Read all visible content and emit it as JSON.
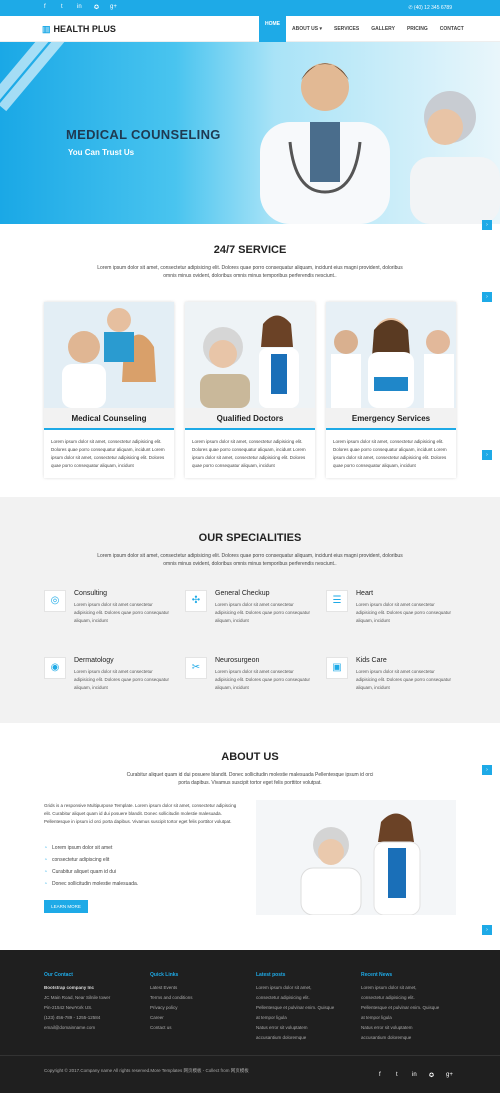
{
  "topbar": {
    "social": [
      "f",
      "t",
      "in",
      "✪",
      "g+"
    ],
    "phone": "(40) 12 345 6789"
  },
  "nav": {
    "brand": "HEALTH PLUS",
    "items": [
      "HOME",
      "ABOUT US ▾",
      "SERVICES",
      "GALLERY",
      "PRICING",
      "CONTACT"
    ]
  },
  "hero": {
    "title": "MEDICAL COUNSELING",
    "subtitle": "You Can Trust Us"
  },
  "service": {
    "title": "24/7 SERVICE",
    "desc": "Lorem ipsum dolor sit amet, consectetur adipisicing elit. Dolores quae porro consequatur aliquam, incidunt eius magni provident, doloribus omnis minus ovident, doloribus omnis minus temporibus perferendis nesciunt..",
    "cards": [
      {
        "label": "Medical Counseling",
        "text": "Lorem ipsum dolor sit amet, consectetur adipisicing elit. Dolores quae porro consequatur aliquam, incidunt Lorem ipsum dolor sit amet, consectetur adipisicing elit. Dolores quae porro consequatur aliquam, incidunt"
      },
      {
        "label": "Qualified Doctors",
        "text": "Lorem ipsum dolor sit amet, consectetur adipisicing elit. Dolores quae porro consequatur aliquam, incidunt Lorem ipsum dolor sit amet, consectetur adipisicing elit. Dolores quae porro consequatur aliquam, incidunt"
      },
      {
        "label": "Emergency Services",
        "text": "Lorem ipsum dolor sit amet, consectetur adipisicing elit. Dolores quae porro consequatur aliquam, incidunt Lorem ipsum dolor sit amet, consectetur adipisicing elit. Dolores quae porro consequatur aliquam, incidunt"
      }
    ]
  },
  "specialities": {
    "title": "OUR SPECIALITIES",
    "desc": "Lorem ipsum dolor sit amet, consectetur adipisicing elit. Dolores quae porro consequatur aliquam, incidunt eius magni provident, doloribus omnis minus ovident, doloribus omnis minus temporibus perferendis nesciunt..",
    "items": [
      {
        "name": "Consulting",
        "text": "Lorem ipsum dolor sit amet consectetur adipisicing elit. Dolores quae porro consequatur aliquam, incidunt"
      },
      {
        "name": "General Checkup",
        "text": "Lorem ipsum dolor sit amet consectetur adipisicing elit. Dolores quae porro consequatur aliquam, incidunt"
      },
      {
        "name": "Heart",
        "text": "Lorem ipsum dolor sit amet consectetur adipisicing elit. Dolores quae porro consequatur aliquam, incidunt"
      },
      {
        "name": "Dermatology",
        "text": "Lorem ipsum dolor sit amet consectetur adipisicing elit. Dolores quae porro consequatur aliquam, incidunt"
      },
      {
        "name": "Neurosurgeon",
        "text": "Lorem ipsum dolor sit amet consectetur adipisicing elit. Dolores quae porro consequatur aliquam, incidunt"
      },
      {
        "name": "Kids Care",
        "text": "Lorem ipsum dolor sit amet consectetur adipisicing elit. Dolores quae porro consequatur aliquam, incidunt"
      }
    ]
  },
  "about": {
    "title": "ABOUT US",
    "desc": "Curabitur aliquet quam id dui posuere blandit. Donec sollicitudin molestie malesuada Pellentesque ipsum id orci porta dapibus. Vivamus suscipit tortor eget felis porttitor volutpat.",
    "text": "Grids is a responsive Multipurpose Template. Lorem ipsum dolor sit amet, consectetur adipiscing elit. Curabitur aliquet quam id dui posuere blandit. Donec sollicitudin molestie malesuada. Pellentesque in ipsum id orci porta dapibus. Vivamus suscipit tortor eget felis porttitor volutpat.",
    "list": [
      "Lorem ipsum dolor sit amet",
      "consectetur adipiscing elit",
      "Curabitur aliquet quam id dui",
      "Donec sollicitudin molestie malesuada."
    ],
    "button": "LEARN MORE"
  },
  "footer": {
    "contact": {
      "h": "Our Contact",
      "lines": [
        "Bootstrap company Inc",
        "JC Main Road, Near Silnile tower",
        "Pin-21542 NewYork US.",
        "(123) 456-789 - 1255-12584",
        "email@domainname.com"
      ]
    },
    "links": {
      "h": "Quick Links",
      "lines": [
        "Latest Events",
        "Terms and conditions",
        "Privacy policy",
        "Career",
        "Contact us"
      ]
    },
    "posts": {
      "h": "Latest posts",
      "lines": [
        "Lorem ipsum dolor sit amet,",
        "consectetur adipisicing elit.",
        "Pellentesque et pulvinar enim. Quisque",
        "at tempor ligula",
        "Natus error sit voluptatem",
        "accusantium doloremque"
      ]
    },
    "news": {
      "h": "Recent News",
      "lines": [
        "Lorem ipsum dolor sit amet,",
        "consectetur adipisicing elit.",
        "Pellentesque et pulvinar enim. Quisque",
        "at tempor ligula",
        "Natus error sit voluptatem",
        "accusantium doloremque"
      ]
    },
    "copyright": "Copyright © 2017.Company name All rights reserved.More Templates 网页模板 - Collect from 网页模板",
    "social": [
      "f",
      "t",
      "in",
      "✪",
      "g+"
    ]
  }
}
